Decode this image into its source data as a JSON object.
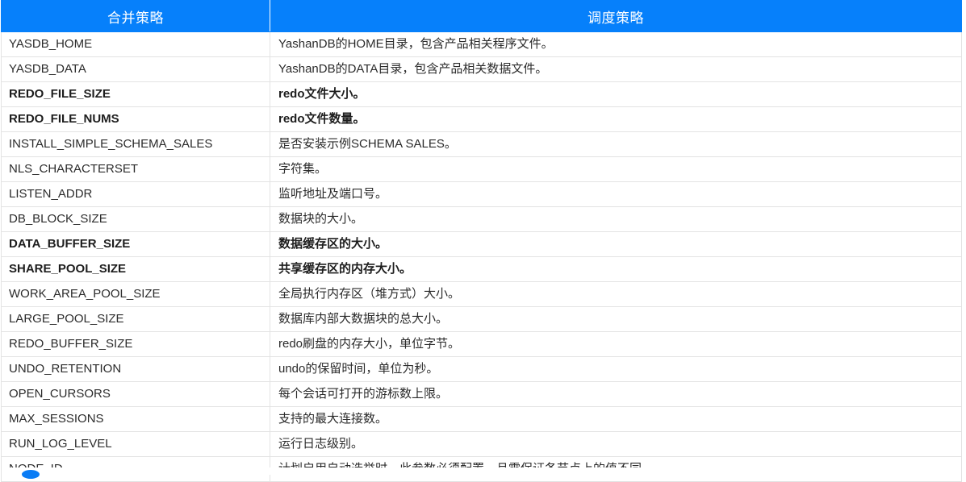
{
  "table": {
    "columns": [
      "合并策略",
      "调度策略"
    ],
    "rows": [
      {
        "name": "YASDB_HOME",
        "desc": "YashanDB的HOME目录，包含产品相关程序文件。",
        "bold": false
      },
      {
        "name": "YASDB_DATA",
        "desc": "YashanDB的DATA目录，包含产品相关数据文件。",
        "bold": false
      },
      {
        "name": "REDO_FILE_SIZE",
        "desc": "redo文件大小。",
        "bold": true
      },
      {
        "name": "REDO_FILE_NUMS",
        "desc": "redo文件数量。",
        "bold": true
      },
      {
        "name": "INSTALL_SIMPLE_SCHEMA_SALES",
        "desc": "是否安装示例SCHEMA SALES。",
        "bold": false
      },
      {
        "name": "NLS_CHARACTERSET",
        "desc": "字符集。",
        "bold": false
      },
      {
        "name": "LISTEN_ADDR",
        "desc": "监听地址及端口号。",
        "bold": false
      },
      {
        "name": "DB_BLOCK_SIZE",
        "desc": "数据块的大小。",
        "bold": false
      },
      {
        "name": "DATA_BUFFER_SIZE",
        "desc": "数据缓存区的大小。",
        "bold": true
      },
      {
        "name": "SHARE_POOL_SIZE",
        "desc": "共享缓存区的内存大小。",
        "bold": true
      },
      {
        "name": "WORK_AREA_POOL_SIZE",
        "desc": "全局执行内存区（堆方式）大小。",
        "bold": false
      },
      {
        "name": "LARGE_POOL_SIZE",
        "desc": "数据库内部大数据块的总大小。",
        "bold": false
      },
      {
        "name": "REDO_BUFFER_SIZE",
        "desc": "redo刷盘的内存大小，单位字节。",
        "bold": false
      },
      {
        "name": "UNDO_RETENTION",
        "desc": "undo的保留时间，单位为秒。",
        "bold": false
      },
      {
        "name": "OPEN_CURSORS",
        "desc": "每个会话可打开的游标数上限。",
        "bold": false
      },
      {
        "name": "MAX_SESSIONS",
        "desc": "支持的最大连接数。",
        "bold": false
      },
      {
        "name": "RUN_LOG_LEVEL",
        "desc": "运行日志级别。",
        "bold": false
      },
      {
        "name": "NODE_ID",
        "desc": "计划启用自动选举时，此参数必须配置，且需保证各节点上的值不同。",
        "bold": false
      }
    ]
  },
  "colors": {
    "header_blue": "#0680fb",
    "row_border": "#e3e3e3",
    "text": "#2b2b2b",
    "marker_blue": "#0a7cf5"
  }
}
